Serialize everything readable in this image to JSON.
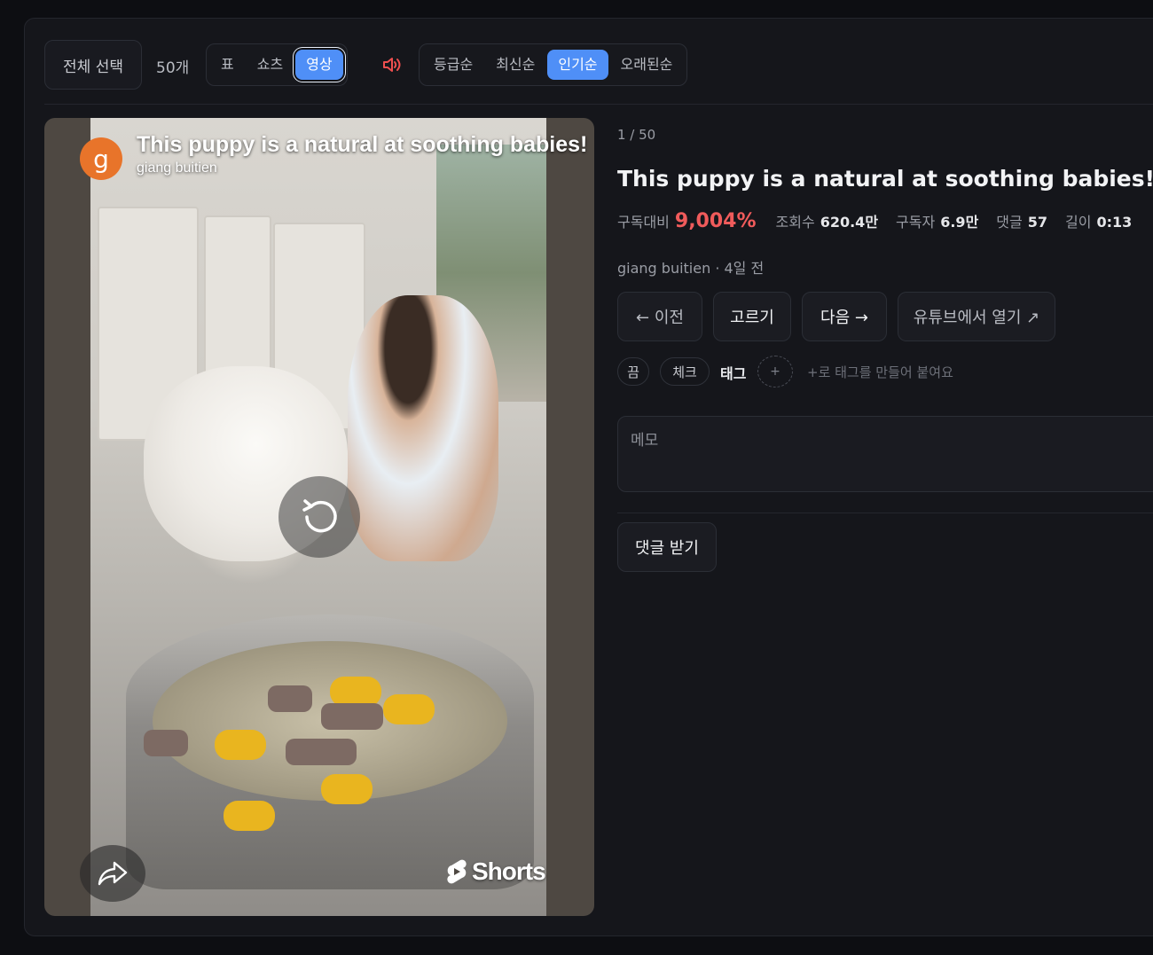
{
  "toolbar": {
    "select_all": "전체 선택",
    "count": "50개",
    "view_modes": [
      "표",
      "쇼츠",
      "영상"
    ],
    "active_view": "영상",
    "sort_options": [
      "등급순",
      "최신순",
      "인기순",
      "오래된순"
    ],
    "active_sort": "인기순"
  },
  "video": {
    "avatar_letter": "g",
    "title": "This puppy is a natural at soothing babies!",
    "channel": "giang buitien",
    "shorts_label": "Shorts"
  },
  "detail": {
    "counter": "1 / 50",
    "title": "This puppy is a natural at soothing babies!",
    "stats": {
      "ratio_label": "구독대비",
      "ratio_value": "9,004%",
      "views_label": "조회수",
      "views_value": "620.4만",
      "subs_label": "구독자",
      "subs_value": "6.9만",
      "comments_label": "댓글",
      "comments_value": "57",
      "length_label": "길이",
      "length_value": "0:13"
    },
    "meta": "giang buitien · 4일 전",
    "buttons": {
      "prev": "← 이전",
      "pick": "고르기",
      "next": "다음 →",
      "open_youtube": "유튜브에서 열기 ↗"
    },
    "chips": {
      "off": "끔",
      "check": "체크"
    },
    "tag_label": "태그",
    "tag_add": "+",
    "tag_hint": "+로 태그를 만들어 붙여요",
    "memo_placeholder": "메모",
    "fetch_comments": "댓글 받기"
  },
  "colors": {
    "accent": "#4f8ff7",
    "ratio": "#f05b5b",
    "avatar": "#e8742a"
  }
}
